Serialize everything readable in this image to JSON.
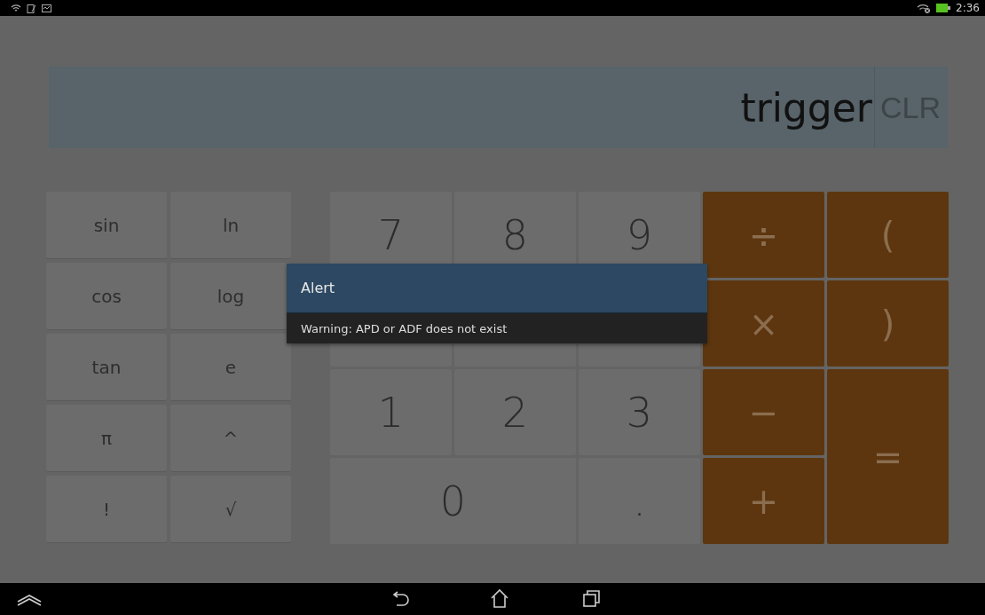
{
  "status_bar": {
    "time": "2:36"
  },
  "display": {
    "expression": "trigger",
    "clear_label": "CLR"
  },
  "scientific_keys": [
    "sin",
    "ln",
    "cos",
    "log",
    "tan",
    "e",
    "π",
    "^",
    "!",
    "√"
  ],
  "keys": [
    {
      "kind": "digit",
      "label": "7"
    },
    {
      "kind": "digit",
      "label": "8"
    },
    {
      "kind": "digit",
      "label": "9"
    },
    {
      "kind": "operator",
      "label": "÷"
    },
    {
      "kind": "operator",
      "label": "("
    },
    {
      "kind": "digit"
    },
    {
      "kind": "digit"
    },
    {
      "kind": "digit"
    },
    {
      "kind": "operator",
      "label": "×"
    },
    {
      "kind": "operator",
      "label": ")"
    },
    {
      "kind": "digit",
      "label": "1"
    },
    {
      "kind": "digit",
      "label": "2"
    },
    {
      "kind": "digit",
      "label": "3"
    },
    {
      "kind": "operator",
      "label": "−"
    },
    {
      "kind": "operator",
      "label": "="
    },
    {
      "kind": "digit",
      "label": "0"
    },
    {
      "kind": "digit",
      "label": "."
    },
    {
      "kind": "operator",
      "label": "+"
    }
  ],
  "alert": {
    "title": "Alert",
    "message": "Warning: APD or ADF does not exist"
  }
}
